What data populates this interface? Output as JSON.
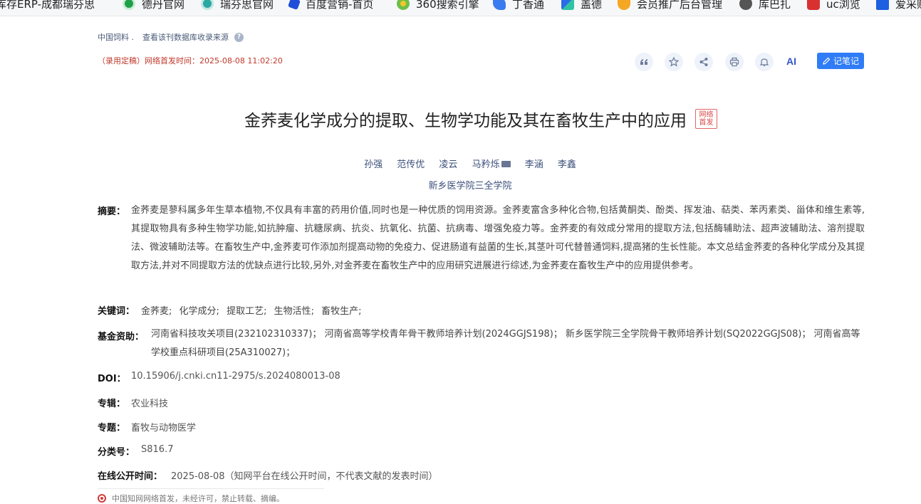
{
  "bookmarks": [
    {
      "label": "库存ERP-成都瑞芬思",
      "icon": "erp-icon"
    },
    {
      "label": "德丹官网",
      "icon": "green-circle-icon"
    },
    {
      "label": "瑞芬思官网",
      "icon": "teal-circle-icon"
    },
    {
      "label": "百度营销-首页",
      "icon": "baidu-paw-icon"
    },
    {
      "label": "360搜索引擎",
      "icon": "flower-icon"
    },
    {
      "label": "丁香通",
      "icon": "jd-icon"
    },
    {
      "label": "盖德",
      "icon": "gaode-icon"
    },
    {
      "label": "会员推广后台管理",
      "icon": "orange-shield-icon"
    },
    {
      "label": "库巴扎",
      "icon": "globe-icon"
    },
    {
      "label": "uc浏览",
      "icon": "uc-icon"
    },
    {
      "label": "爱采购",
      "icon": "grid-icon"
    }
  ],
  "meta": {
    "source": "中国饲料 .",
    "check_link": "查看该刊数据库收录来源"
  },
  "pub_time": "（录用定稿）网络首发时间：2025-08-08 11:02:20",
  "toolbar": {
    "ai_label": "AI",
    "note_label": "记笔记"
  },
  "article": {
    "title": "金荞麦化学成分的提取、生物学功能及其在畜牧生产中的应用",
    "badge": "网络首发",
    "authors": [
      "孙强",
      "范传优",
      "凌云",
      "马矜烁",
      "李涵",
      "李鑫"
    ],
    "affiliation": "新乡医学院三全学院",
    "abstract_label": "摘要：",
    "abstract": "金荞麦是蓼科属多年生草本植物,不仅具有丰富的药用价值,同时也是一种优质的饲用资源。金荞麦富含多种化合物,包括黄酮类、酚类、挥发油、萜类、苯丙素类、甾体和维生素等,其提取物具有多种生物学功能,如抗肿瘤、抗糖尿病、抗炎、抗氧化、抗菌、抗病毒、增强免疫力等。金荞麦的有效成分常用的提取方法,包括酶辅助法、超声波辅助法、溶剂提取法、微波辅助法等。在畜牧生产中,金荞麦可作添加剂提高动物的免疫力、促进肠道有益菌的生长,其茎叶可代替普通饲料,提高猪的生长性能。本文总结金荞麦的各种化学成分及其提取方法,并对不同提取方法的优缺点进行比较,另外,对金荞麦在畜牧生产中的应用研究进展进行综述,为金荞麦在畜牧生产中的应用提供参考。",
    "keywords_label": "关键词：",
    "keywords": [
      "金荞麦;",
      "化学成分;",
      "提取工艺;",
      "生物活性;",
      "畜牧生产;"
    ],
    "fund_label": "基金资助：",
    "fund": "河南省科技攻关项目(232102310337)； 河南省高等学校青年骨干教师培养计划(2024GGJS198)； 新乡医学院三全学院骨干教师培养计划(SQ2022GGJS08)； 河南省高等学校重点科研项目(25A310027)；",
    "doi_label": "DOI：",
    "doi": "10.15906/j.cnki.cn11-2975/s.2024080013-08",
    "series_label": "专辑：",
    "series": "农业科技",
    "topic_label": "专题：",
    "topic": "畜牧与动物医学",
    "class_label": "分类号：",
    "class_no": "S816.7",
    "online_label": "在线公开时间：",
    "online_time": "2025-08-08（知网平台在线公开时间，不代表文献的发表时间）"
  },
  "footer_note": "中国知网网络首发，未经许可，禁止转载、摘编。"
}
